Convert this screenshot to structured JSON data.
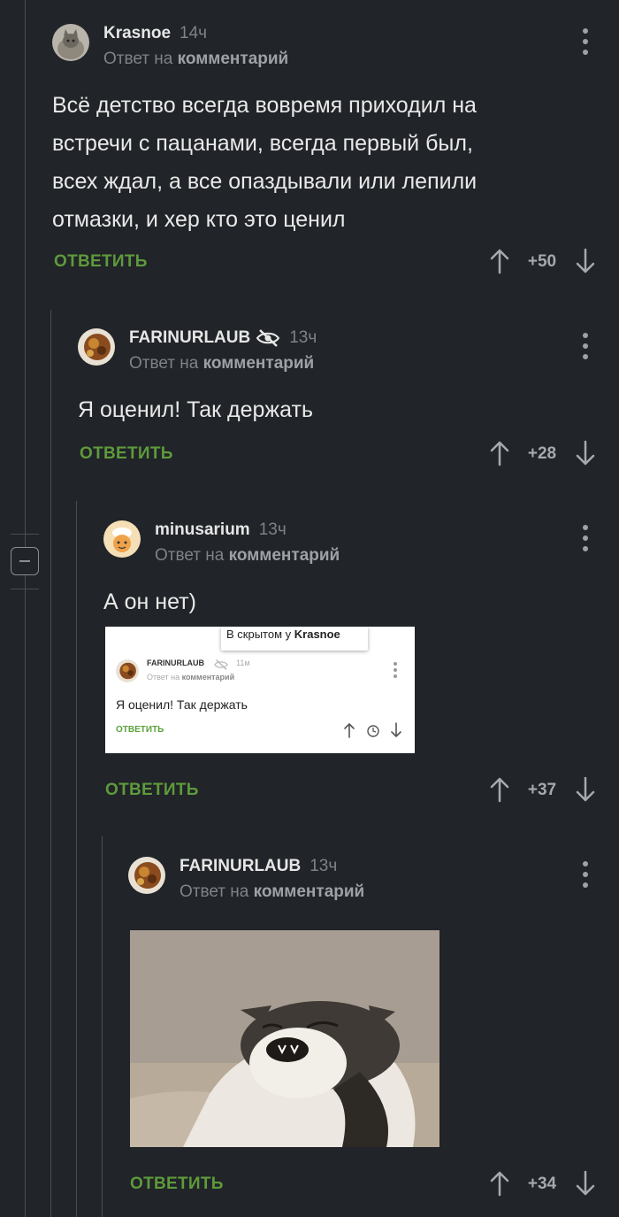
{
  "comments": [
    {
      "author": "Krasnoe",
      "time": "14ч",
      "reply_prefix": "Ответ на",
      "reply_target": "комментарий",
      "text_lines": [
        "Всё детство всегда вовремя приходил на",
        "встречи с пацанами, всегда первый был,",
        "всех ждал, а все опаздывали или лепили",
        "отмазки, и хер кто это ценил"
      ],
      "reply_label": "ОТВЕТИТЬ",
      "rating": "+50",
      "avatar_icon": "cat-avatar"
    },
    {
      "author": "FARINURLAUB",
      "time": "13ч",
      "reply_prefix": "Ответ на",
      "reply_target": "комментарий",
      "text_lines": [
        "Я оценил! Так держать"
      ],
      "reply_label": "ОТВЕТИТЬ",
      "rating": "+28",
      "avatar_icon": "food-avatar",
      "badge_icon": "eye-slash-icon"
    },
    {
      "author": "minusarium",
      "time": "13ч",
      "reply_prefix": "Ответ на",
      "reply_target": "комментарий",
      "text_lines": [
        "А он нет)"
      ],
      "reply_label": "ОТВЕТИТЬ",
      "rating": "+37",
      "avatar_icon": "character-avatar",
      "embedded_screenshot": {
        "tooltip_prefix": "В скрытом у",
        "tooltip_user": "Krasnoe",
        "author": "FARINURLAUB",
        "time": "11м",
        "reply_prefix": "Ответ на",
        "reply_target": "комментарий",
        "text": "Я оценил! Так держать",
        "reply_label": "ОТВЕТИТЬ"
      }
    },
    {
      "author": "FARINURLAUB",
      "time": "13ч",
      "reply_prefix": "Ответ на",
      "reply_target": "комментарий",
      "reply_label": "ОТВЕТИТЬ",
      "rating": "+34",
      "avatar_icon": "food-avatar",
      "media": "screaming-cat-image"
    }
  ],
  "colors": {
    "background": "#212428",
    "text": "#e6e6e6",
    "muted": "#7f8287",
    "reply_green": "#5e9a3c",
    "thread_line": "#4a4d52"
  }
}
